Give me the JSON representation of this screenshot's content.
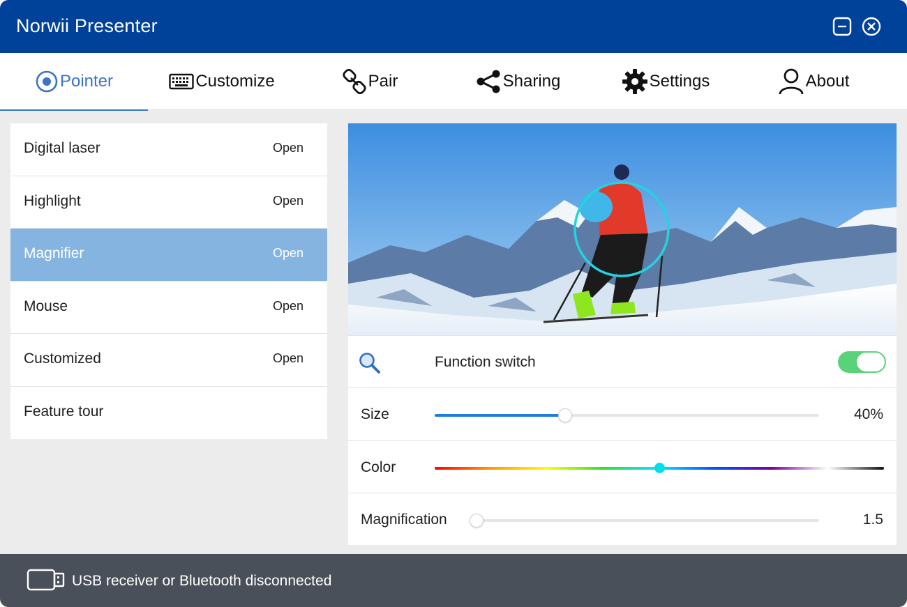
{
  "window": {
    "title": "Norwii Presenter"
  },
  "tabs": [
    {
      "label": "Pointer",
      "icon": "pointer-icon",
      "active": true
    },
    {
      "label": "Customize",
      "icon": "keyboard-icon"
    },
    {
      "label": "Pair",
      "icon": "link-icon"
    },
    {
      "label": "Sharing",
      "icon": "share-icon"
    },
    {
      "label": "Settings",
      "icon": "gear-icon"
    },
    {
      "label": "About",
      "icon": "user-icon"
    }
  ],
  "features": [
    {
      "label": "Digital laser",
      "status": "Open"
    },
    {
      "label": "Highlight",
      "status": "Open"
    },
    {
      "label": "Magnifier",
      "status": "Open",
      "selected": true
    },
    {
      "label": "Mouse",
      "status": "Open"
    },
    {
      "label": "Customized",
      "status": "Open"
    },
    {
      "label": "Feature tour",
      "status": ""
    }
  ],
  "settings": {
    "function_switch": {
      "label": "Function switch",
      "on": true,
      "icon": "magnifier-icon"
    },
    "size": {
      "label": "Size",
      "value": "40%",
      "fraction": 0.34
    },
    "color": {
      "label": "Color",
      "selected_hex": "#00e0ec",
      "fraction": 0.5
    },
    "magnification": {
      "label": "Magnification",
      "value": "1.5",
      "fraction": 0.0
    }
  },
  "status": {
    "text": "USB receiver or Bluetooth disconnected",
    "icon": "usb-icon"
  },
  "colors": {
    "titlebar": "#00419a",
    "accent": "#3a74c4",
    "selected_row": "#86b4e0",
    "toggle_on": "#5ad27a",
    "slider_fill": "#1e7be0",
    "statusbar": "#4a5059"
  }
}
